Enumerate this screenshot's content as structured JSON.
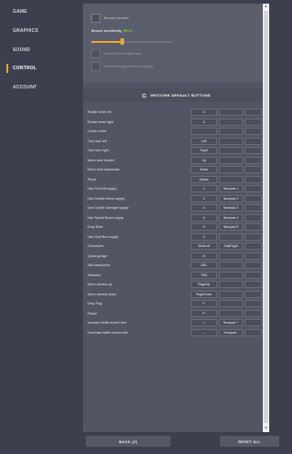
{
  "sidebar": {
    "items": [
      {
        "label": "GAME"
      },
      {
        "label": "GRAPHICS"
      },
      {
        "label": "SOUND"
      },
      {
        "label": "CONTROL",
        "active": true
      },
      {
        "label": "ACCOUNT"
      }
    ]
  },
  "controls": {
    "mouse_controls": {
      "label": "Mouse controls",
      "checked": false
    },
    "sensitivity": {
      "label": "Mouse sensitivity",
      "value_text": "(50%)",
      "value": 0.5
    },
    "invert_shift": {
      "label": "Invert Shift vertical axis",
      "checked": false
    },
    "invert_steering": {
      "label": "Invert steering when reversing",
      "checked": false
    },
    "restore_label": "RESTORE DEFAULT BUTTONS"
  },
  "bindings": [
    {
      "action": "Rotate turret left",
      "primary": "Z",
      "secondary": ""
    },
    {
      "action": "Rotate turret right",
      "primary": "X",
      "secondary": ""
    },
    {
      "action": "Center turret",
      "primary": "",
      "secondary": ""
    },
    {
      "action": "Turn tank left",
      "primary": "Left",
      "secondary": ""
    },
    {
      "action": "Turn tank right",
      "primary": "Right",
      "secondary": ""
    },
    {
      "action": "Move tank forward",
      "primary": "Up",
      "secondary": ""
    },
    {
      "action": "Move tank backwards",
      "primary": "Down",
      "secondary": ""
    },
    {
      "action": "Shoot",
      "primary": "Space",
      "secondary": ""
    },
    {
      "action": "Use First Aid supply",
      "primary": "1",
      "secondary": "Numpad 1"
    },
    {
      "action": "Use Double Armor supply",
      "primary": "2",
      "secondary": "Numpad 2"
    },
    {
      "action": "Use Double Damage supply",
      "primary": "3",
      "secondary": "Numpad 3"
    },
    {
      "action": "Use Speed Boost supply",
      "primary": "4",
      "secondary": "Numpad 4"
    },
    {
      "action": "Drop Mine",
      "primary": "5",
      "secondary": "Numpad 5"
    },
    {
      "action": "Use Gold Box supply",
      "primary": "6",
      "secondary": ""
    },
    {
      "action": "Overdrives",
      "primary": "ShiftLeft",
      "secondary": "ShiftRight"
    },
    {
      "action": "Quick garage",
      "primary": "G",
      "secondary": ""
    },
    {
      "action": "Self-destruction",
      "primary": "DEL",
      "secondary": ""
    },
    {
      "action": "Statistics",
      "primary": "TAB",
      "secondary": ""
    },
    {
      "action": "Move camera up",
      "primary": "PageUp",
      "secondary": ""
    },
    {
      "action": "Move camera down",
      "primary": "PageDown",
      "secondary": ""
    },
    {
      "action": "Drop Flag",
      "primary": "F",
      "secondary": ""
    },
    {
      "action": "Pause",
      "primary": "P",
      "secondary": ""
    },
    {
      "action": "Increase battle screen size",
      "primary": "=",
      "secondary": "Numpad +"
    },
    {
      "action": "Decrease battle screen size",
      "primary": "–",
      "secondary": "Numpad -"
    }
  ],
  "footer": {
    "back_label": "BACK (Z)",
    "reset_label": "RESET ALL"
  },
  "colors": {
    "accent": "#f5a623",
    "sensitivity_value": "#7ed321",
    "background": "#3b3f4e"
  }
}
